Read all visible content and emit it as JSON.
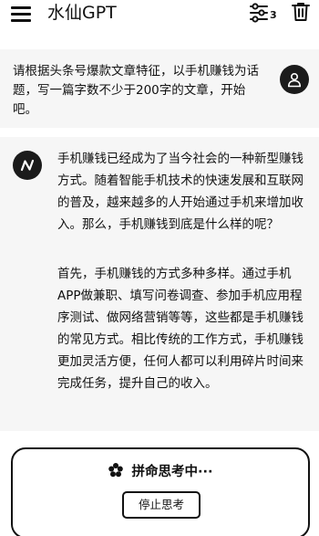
{
  "header": {
    "title": "水仙GPT",
    "conversation_count": "3",
    "icons": {
      "menu": "hamburger-menu-icon",
      "conversations": "sliders-icon",
      "delete": "trash-icon"
    }
  },
  "user_message": {
    "text": "请根据头条号爆款文章特征，以手机赚钱为话题，写一篇字数不少于200字的文章，开始吧。",
    "avatar_icon": "user-icon"
  },
  "bot_message": {
    "avatar_icon": "openai-logo-icon",
    "paragraphs": [
      "手机赚钱已经成为了当今社会的一种新型赚钱方式。随着智能手机技术的快速发展和互联网的普及，越来越多的人开始通过手机来增加收入。那么，手机赚钱到底是什么样的呢？",
      "首先，手机赚钱的方式多种多样。通过手机APP做兼职、填写问卷调查、参加手机应用程序测试、做网络营销等等，这些都是手机赚钱的常见方式。相比传统的工作方式，手机赚钱更加灵活方便，任何人都可以利用碎片时间来完成任务，提升自己的收入。"
    ]
  },
  "thinking": {
    "status": "拼命思考中···",
    "icon": "flower-spinner-icon",
    "stop_label": "停止思考"
  },
  "colors": {
    "background": "#ffffff",
    "message_background": "#f6f6f6",
    "text": "#111111",
    "avatar": "#1b1b1b"
  }
}
